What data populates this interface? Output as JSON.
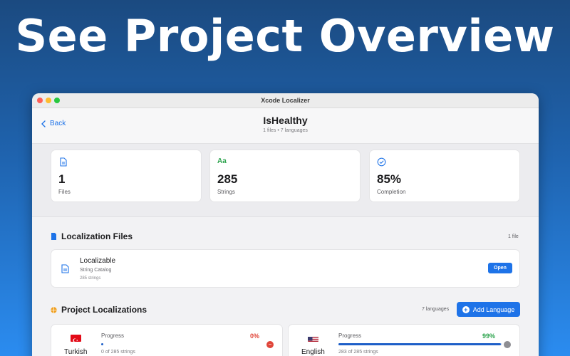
{
  "hero": {
    "title": "See Project Overview"
  },
  "window": {
    "title": "Xcode Localizer"
  },
  "nav": {
    "back_label": "Back",
    "title": "IsHealthy",
    "subtitle": "1 files • 7 languages"
  },
  "stats": [
    {
      "value": "1",
      "label": "Files",
      "icon": "document-icon"
    },
    {
      "value": "285",
      "label": "Strings",
      "icon": "text-aa-icon",
      "glyph": "Aa"
    },
    {
      "value": "85%",
      "label": "Completion",
      "icon": "checkmark-circle-icon"
    }
  ],
  "files_section": {
    "title": "Localization Files",
    "count": "1 file",
    "file": {
      "name": "Localizable",
      "type": "String Catalog",
      "strings": "285 strings",
      "open_label": "Open"
    }
  },
  "localizations_section": {
    "title": "Project Localizations",
    "count": "7 languages",
    "add_label": "Add Language",
    "languages": [
      {
        "name": "Turkish",
        "progress_label": "Progress",
        "percent": "0%",
        "progress": 0.004,
        "count": "0 of 285 strings",
        "flag": "turkey-flag-icon",
        "pct_color": "#e0463a"
      },
      {
        "name": "English",
        "progress_label": "Progress",
        "percent": "99%",
        "progress": 0.99,
        "count": "283 of 285 strings",
        "flag": "usa-flag-icon",
        "pct_color": "#2da44e"
      }
    ]
  },
  "colors": {
    "accent": "#1e73e8",
    "success": "#2da44e",
    "danger": "#e0463a"
  }
}
